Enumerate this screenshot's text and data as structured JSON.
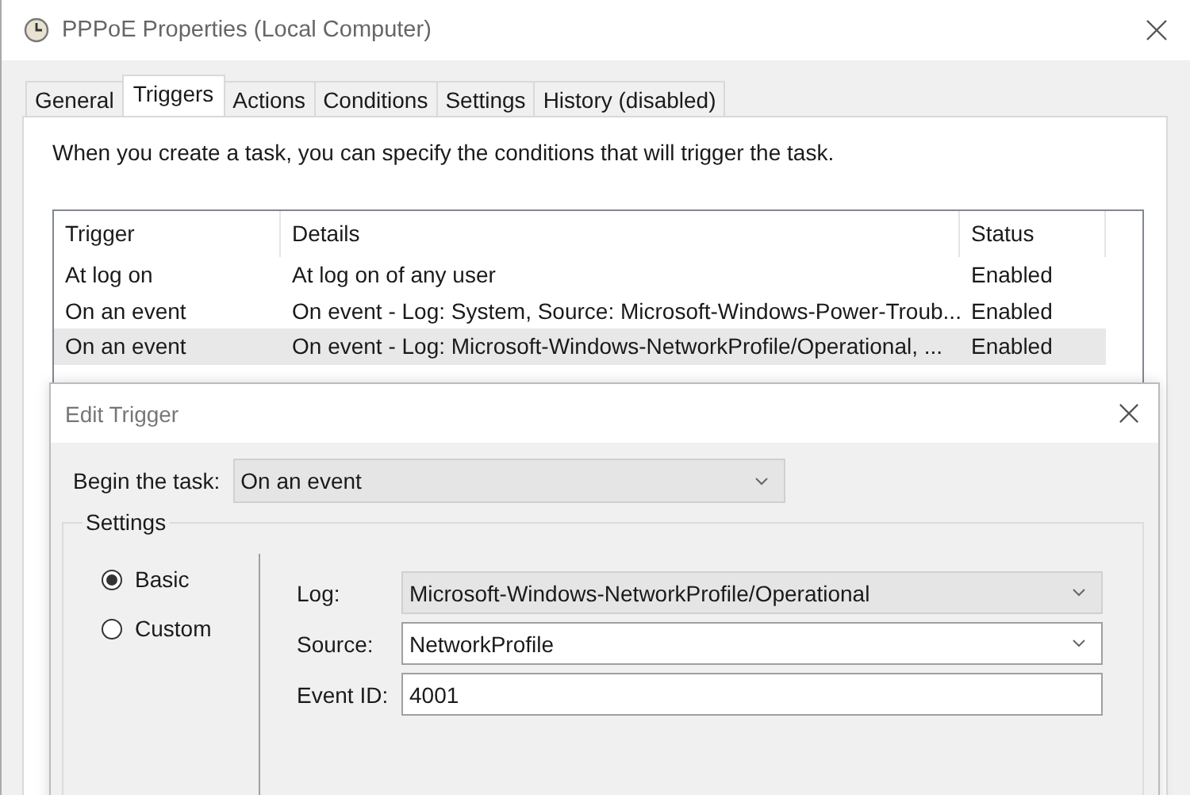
{
  "window": {
    "title": "PPPoE Properties (Local Computer)"
  },
  "tabs": [
    {
      "label": "General",
      "selected": false
    },
    {
      "label": "Triggers",
      "selected": true
    },
    {
      "label": "Actions",
      "selected": false
    },
    {
      "label": "Conditions",
      "selected": false
    },
    {
      "label": "Settings",
      "selected": false
    },
    {
      "label": "History (disabled)",
      "selected": false
    }
  ],
  "description": "When you create a task, you can specify the conditions that will trigger the task.",
  "table": {
    "columns": [
      "Trigger",
      "Details",
      "Status"
    ],
    "rows": [
      {
        "cells": [
          "At log on",
          "At log on of any user",
          "Enabled"
        ],
        "selected": false
      },
      {
        "cells": [
          "On an event",
          "On event - Log: System, Source: Microsoft-Windows-Power-Troub...",
          "Enabled"
        ],
        "selected": false
      },
      {
        "cells": [
          "On an event",
          "On event - Log: Microsoft-Windows-NetworkProfile/Operational, ...",
          "Enabled"
        ],
        "selected": true
      }
    ]
  },
  "dialog": {
    "title": "Edit Trigger",
    "begin": {
      "label": "Begin the task:",
      "value": "On an event"
    },
    "settings_label": "Settings",
    "modes": [
      {
        "label": "Basic",
        "selected": true
      },
      {
        "label": "Custom",
        "selected": false
      }
    ],
    "fields": [
      {
        "label": "Log:",
        "value": "Microsoft-Windows-NetworkProfile/Operational",
        "kind": "dropdown"
      },
      {
        "label": "Source:",
        "value": "NetworkProfile",
        "kind": "combo"
      },
      {
        "label": "Event ID:",
        "value": "4001",
        "kind": "text"
      }
    ]
  }
}
